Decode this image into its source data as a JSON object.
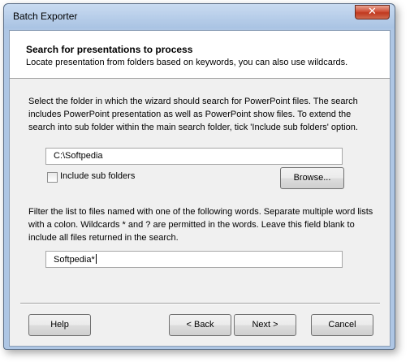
{
  "window": {
    "title": "Batch Exporter",
    "close_glyph": "✕"
  },
  "header": {
    "title": "Search for presentations to process",
    "subtitle": "Locate presentation from folders based on keywords, you can also use wildcards."
  },
  "folder_section": {
    "description": "Select the folder in which the wizard should search for PowerPoint files. The search includes PowerPoint presentation as well as PowerPoint show files. To extend the search into sub folder within the main search folder, tick 'Include sub folders' option.",
    "folder_value": "C:\\Softpedia",
    "include_subfolders_label": "Include sub folders",
    "include_subfolders_checked": false,
    "browse_label": "Browse..."
  },
  "filter_section": {
    "description": "Filter the list to files named with one of the following words. Separate multiple word lists with a colon. Wildcards * and ? are permitted in the words. Leave this field blank to include all files returned in the search.",
    "filter_value": "Softpedia*"
  },
  "footer": {
    "help_label": "Help",
    "back_label": "< Back",
    "next_label": "Next >",
    "cancel_label": "Cancel"
  }
}
